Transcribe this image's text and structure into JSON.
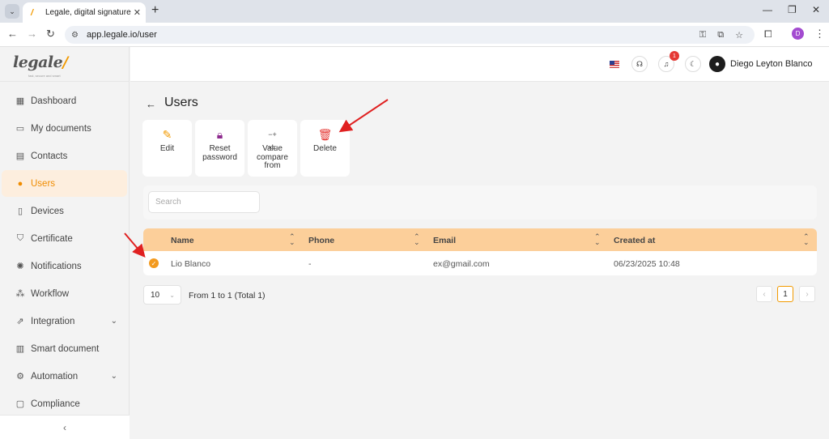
{
  "browser": {
    "tab_title": "Legale, digital signature",
    "url": "app.legale.io/user",
    "profile_initial": "D",
    "icons": {
      "tab_list": "chevron-down-icon",
      "close": "close-icon",
      "new_tab": "plus-icon",
      "back": "arrow-left-icon",
      "forward": "arrow-right-icon",
      "reload": "reload-icon",
      "site_info": "tune-icon",
      "password": "key-icon",
      "install": "install-icon",
      "bookmark": "star-icon",
      "extensions": "puzzle-icon",
      "menu": "kebab-icon"
    }
  },
  "sidebar": {
    "logo": "legale",
    "logo_tagline": "fast, secure and smart",
    "items": [
      {
        "label": "Dashboard",
        "icon": "dashboard-icon"
      },
      {
        "label": "My documents",
        "icon": "folder-icon"
      },
      {
        "label": "Contacts",
        "icon": "contacts-icon"
      },
      {
        "label": "Users",
        "icon": "user-icon",
        "active": true
      },
      {
        "label": "Devices",
        "icon": "tablet-icon"
      },
      {
        "label": "Certificate",
        "icon": "shield-icon"
      },
      {
        "label": "Notifications",
        "icon": "alarm-icon"
      },
      {
        "label": "Workflow",
        "icon": "workflow-icon"
      },
      {
        "label": "Integration",
        "icon": "external-link-icon",
        "expandable": true
      },
      {
        "label": "Smart document",
        "icon": "smart-document-icon"
      },
      {
        "label": "Automation",
        "icon": "automation-icon",
        "expandable": true
      },
      {
        "label": "Compliance",
        "icon": "chat-icon"
      }
    ],
    "collapse_glyph": "‹"
  },
  "topbar": {
    "language_flag": "us-flag",
    "notification_count": "1",
    "user_name": "Diego Leyton Blanco"
  },
  "page": {
    "title": "Users",
    "actions": [
      {
        "label": "Edit",
        "icon": "pencil-icon",
        "color": "#f29a00"
      },
      {
        "label": "Reset password",
        "icon": "lock-icon",
        "color": "#8e2a8e"
      },
      {
        "label": "Value compare from",
        "icon": "calculator-icon",
        "color": "#555555"
      },
      {
        "label": "Delete",
        "icon": "trash-icon",
        "color": "#e53935"
      }
    ],
    "search_placeholder": "Search"
  },
  "table": {
    "columns": [
      "Name",
      "Phone",
      "Email",
      "Created at"
    ],
    "rows": [
      {
        "name": "Lio Blanco",
        "phone": "-",
        "email": "ex@gmail.com",
        "created_at": "06/23/2025 10:48",
        "checked": true
      }
    ]
  },
  "pagination": {
    "page_size": "10",
    "range_text": "From 1 to 1 (Total 1)",
    "current_page": "1",
    "prev": "‹",
    "next": "›"
  },
  "colors": {
    "accent": "#f29a00",
    "header_bg": "#fccf9a",
    "active_nav_bg": "#fdeede",
    "annotation_arrow": "#e02020"
  }
}
